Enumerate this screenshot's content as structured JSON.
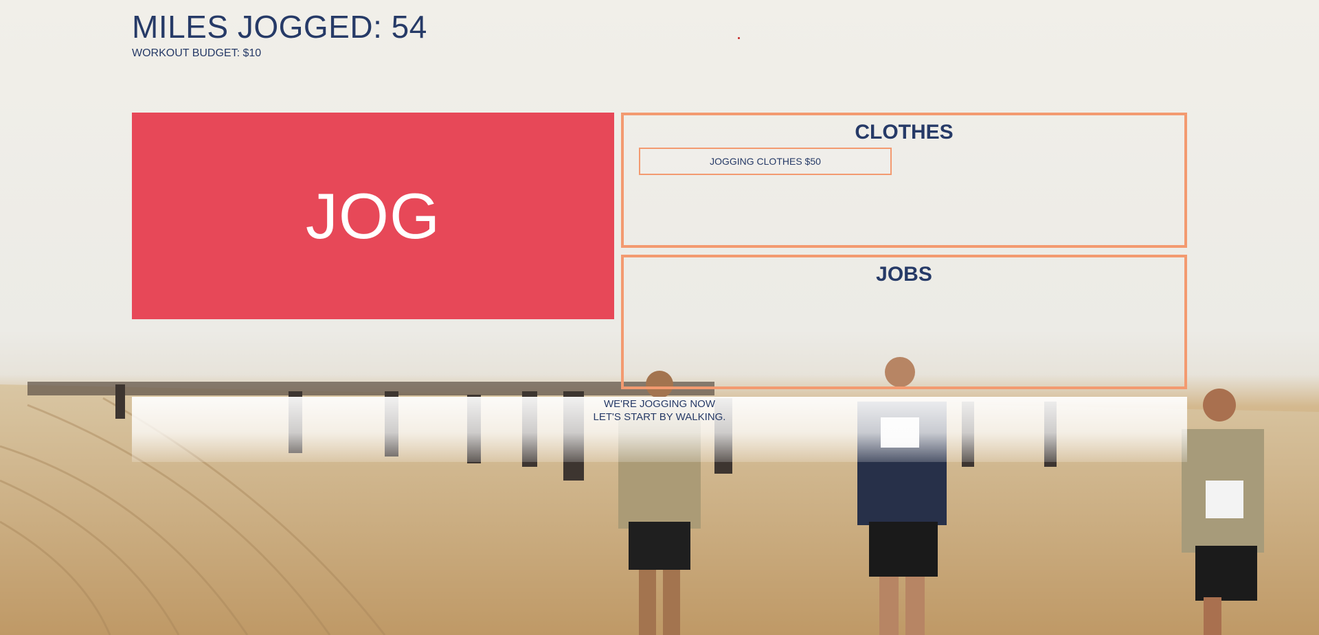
{
  "stats": {
    "miles_label": "MILES JOGGED: ",
    "miles_value": "54",
    "budget_label": "WORKOUT BUDGET: ",
    "budget_value": "$10"
  },
  "jog_button": {
    "label": "JOG"
  },
  "clothes_panel": {
    "title": "CLOTHES",
    "items": [
      {
        "label": "JOGGING CLOTHES $50"
      }
    ]
  },
  "jobs_panel": {
    "title": "JOBS"
  },
  "message": {
    "line1": "WE'RE JOGGING NOW",
    "line2": "LET'S START BY WALKING."
  },
  "colors": {
    "text": "#263a67",
    "jog_button": "#e74858",
    "panel_border": "#f39a70"
  }
}
